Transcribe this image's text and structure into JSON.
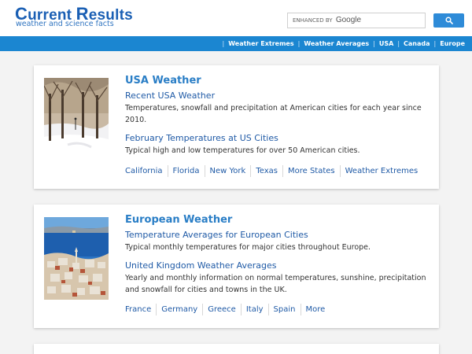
{
  "site": {
    "logo_first": "C",
    "logo_rest1": "urrent ",
    "logo_second": "R",
    "logo_rest2": "esults",
    "tagline": "weather and science facts"
  },
  "search": {
    "enhanced_label": "ENHANCED BY",
    "google_label": "Google",
    "button_icon": "search-icon"
  },
  "nav": {
    "items": [
      "Weather Extremes",
      "Weather Averages",
      "USA",
      "Canada",
      "Europe"
    ]
  },
  "cards": [
    {
      "title": "USA Weather",
      "link1": "Recent USA Weather",
      "desc1": "Temperatures, snowfall and precipitation at American cities for each year since 2010.",
      "link2": "February Temperatures at US Cities",
      "desc2": "Typical high and low temperatures for over 50 American cities.",
      "links": [
        "California",
        "Florida",
        "New York",
        "Texas",
        "More States",
        "Weather Extremes"
      ]
    },
    {
      "title": "European Weather",
      "link1": "Temperature Averages for European Cities",
      "desc1": "Typical monthly temperatures for major cities throughout Europe.",
      "link2": "United Kingdom Weather Averages",
      "desc2": "Yearly and monthly information on normal temperatures, sunshine, precipitation and snowfall for cities and towns in the UK.",
      "links": [
        "France",
        "Germany",
        "Greece",
        "Italy",
        "Spain",
        "More"
      ]
    }
  ],
  "colors": {
    "brand_blue": "#1a5fb4",
    "nav_bar": "#1b86d1",
    "title_blue": "#2a7ec6",
    "link_blue": "#1f5aa6"
  }
}
